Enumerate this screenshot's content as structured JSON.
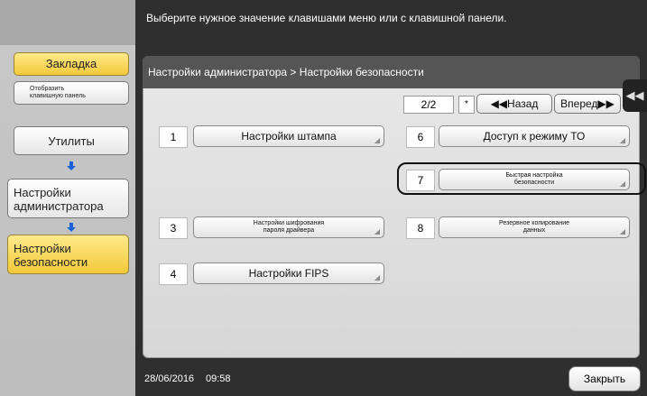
{
  "header": {
    "message": "Выберите нужное значение клавишами меню или с клавишной панели."
  },
  "left": {
    "bookmark": "Закладка",
    "show_panel_line1": "Отобразить",
    "show_panel_line2": "клавишную панель",
    "utilities": "Утилиты",
    "admin_line1": "Настройки",
    "admin_line2": "администратора",
    "security_line1": "Настройки",
    "security_line2": "безопасности"
  },
  "panel": {
    "breadcrumb": "Настройки администратора > Настройки безопасности",
    "page": "2/2",
    "star": "*",
    "back": "◀◀Назад",
    "forward": "Вперед▶▶"
  },
  "items": [
    {
      "num": "1",
      "label": "Настройки штампа"
    },
    {
      "num": "6",
      "label": "Доступ к режиму ТО"
    },
    {
      "num": "7",
      "label_line1": "Быстрая настройка",
      "label_line2": "безопасности"
    },
    {
      "num": "3",
      "label_line1": "Настройки шифрования",
      "label_line2": "пароля драйвера"
    },
    {
      "num": "8",
      "label_line1": "Резервное копирование",
      "label_line2": "данных"
    },
    {
      "num": "4",
      "label": "Настройки FIPS"
    }
  ],
  "footer": {
    "date": "28/06/2016",
    "time": "09:58",
    "close": "Закрыть"
  }
}
